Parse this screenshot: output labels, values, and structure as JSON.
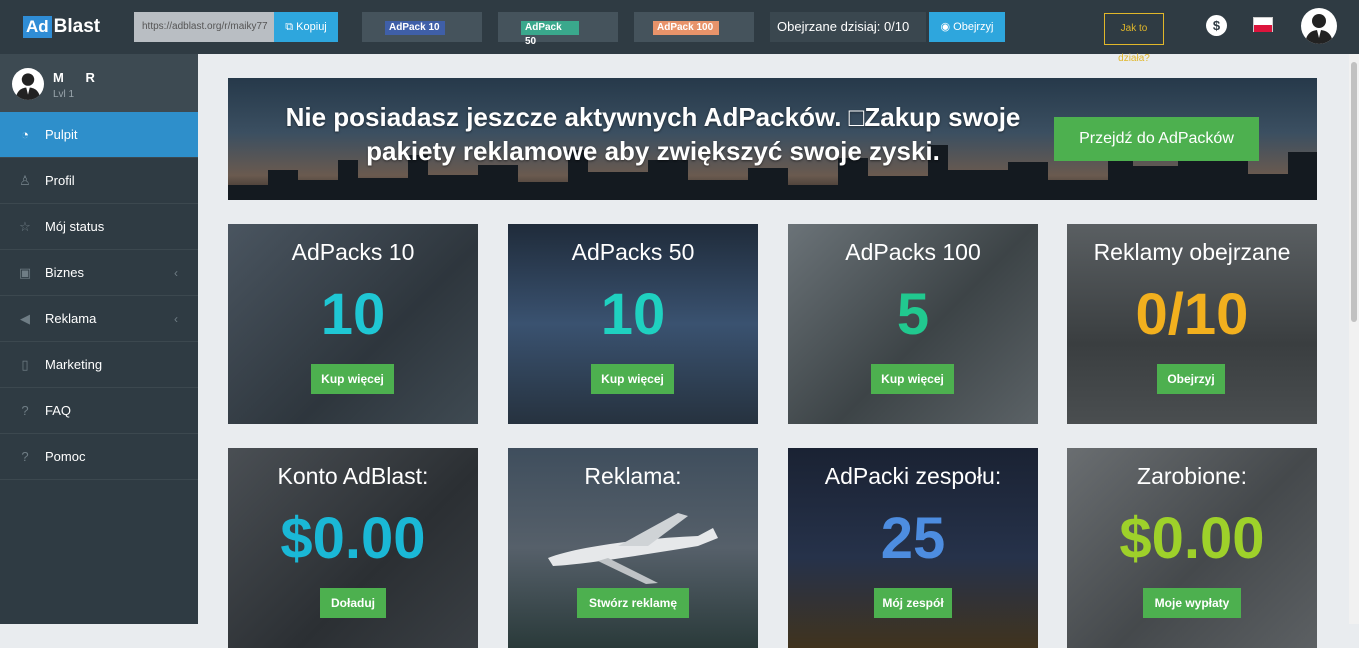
{
  "header": {
    "logo_ad": "Ad",
    "logo_blast": "Blast",
    "ref_link": "https://adblast.org/r/maiky77",
    "copy_label": "Kopiuj",
    "packs": [
      {
        "label": "AdPack 10",
        "color": "#3f5fa8"
      },
      {
        "label": "AdPack 50",
        "color": "#3aa88c"
      },
      {
        "label": "AdPack 100",
        "color": "#e8936a"
      }
    ],
    "viewed_today": "Obejrzane dzisiaj: 0/10",
    "watch_label": "Obejrzyj",
    "how_label": "Jak to działa?",
    "dollar_icon": "dollar-icon",
    "language_flag": "flag-pl-icon"
  },
  "user": {
    "name": "M      R",
    "level": "Lvl 1"
  },
  "sidebar": {
    "items": [
      {
        "label": "Pulpit",
        "icon": "dashboard-icon",
        "active": true
      },
      {
        "label": "Profil",
        "icon": "user-icon"
      },
      {
        "label": "Mój status",
        "icon": "star-icon"
      },
      {
        "label": "Biznes",
        "icon": "briefcase-icon",
        "submenu": true
      },
      {
        "label": "Reklama",
        "icon": "megaphone-icon",
        "submenu": true
      },
      {
        "label": "Marketing",
        "icon": "mobile-icon"
      },
      {
        "label": "FAQ",
        "icon": "question-icon"
      },
      {
        "label": "Pomoc",
        "icon": "question-icon"
      }
    ]
  },
  "banner": {
    "text": "Nie posiadasz jeszcze aktywnych AdPacków. □Zakup swoje pakiety reklamowe aby zwiększyć swoje zyski.",
    "button": "Przejdź do AdPacków"
  },
  "cards": [
    {
      "title": "AdPacks 10",
      "value": "10",
      "button": "Kup więcej",
      "value_color": "#1fc7d4"
    },
    {
      "title": "AdPacks 50",
      "value": "10",
      "button": "Kup więcej",
      "value_color": "#1fd1c0"
    },
    {
      "title": "AdPacks 100",
      "value": "5",
      "button": "Kup więcej",
      "value_color": "#21c98f"
    },
    {
      "title": "Reklamy obejrzane",
      "value": "0/10",
      "button": "Obejrzyj",
      "value_color": "#f2b01e"
    },
    {
      "title": "Konto AdBlast:",
      "value": "$0.00",
      "button": "Doładuj",
      "value_color": "#1ab8d6"
    },
    {
      "title": "Reklama:",
      "value": "",
      "button": "Stwórz reklamę",
      "value_color": "#ffffff"
    },
    {
      "title": "AdPacki zespołu:",
      "value": "25",
      "button": "Mój zespół",
      "value_color": "#4d8de0"
    },
    {
      "title": "Zarobione:",
      "value": "$0.00",
      "button": "Moje wypłaty",
      "value_color": "#9ed12a"
    }
  ]
}
